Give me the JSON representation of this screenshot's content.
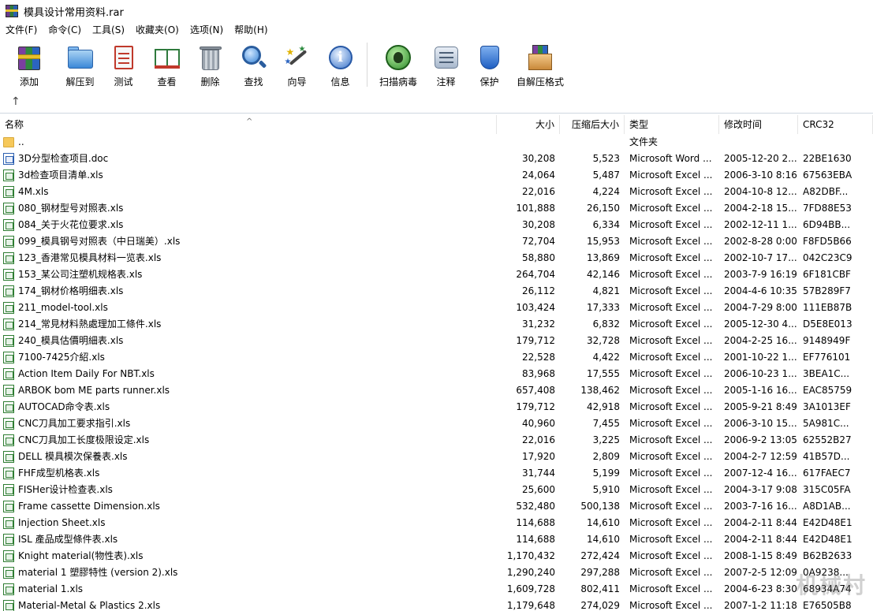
{
  "window": {
    "title": "模具设计常用资料.rar"
  },
  "menu": [
    "文件(F)",
    "命令(C)",
    "工具(S)",
    "收藏夹(O)",
    "选项(N)",
    "帮助(H)"
  ],
  "toolbar": {
    "add": "添加",
    "extract": "解压到",
    "test": "测试",
    "view": "查看",
    "delete": "删除",
    "find": "查找",
    "wizard": "向导",
    "info": "信息",
    "virus_scan": "扫描病毒",
    "comment": "注释",
    "protect": "保护",
    "sfx": "自解压格式"
  },
  "nav": {
    "up_icon": "up-arrow-icon"
  },
  "columns": {
    "name": "名称",
    "size": "大小",
    "packed": "压缩后大小",
    "type": "类型",
    "modified": "修改时间",
    "crc": "CRC32"
  },
  "files": [
    {
      "name": "..",
      "size": "",
      "packed": "",
      "type": "文件夹",
      "modified": "",
      "crc": "",
      "icon": "folder-icon"
    },
    {
      "name": "3D分型检查项目.doc",
      "size": "30,208",
      "packed": "5,523",
      "type": "Microsoft Word ...",
      "modified": "2005-12-20 2...",
      "crc": "22BE1630",
      "icon": "word-doc-icon"
    },
    {
      "name": "3d检查项目清单.xls",
      "size": "24,064",
      "packed": "5,487",
      "type": "Microsoft Excel ...",
      "modified": "2006-3-10 8:16",
      "crc": "67563EBA",
      "icon": "excel-xls-icon"
    },
    {
      "name": "4M.xls",
      "size": "22,016",
      "packed": "4,224",
      "type": "Microsoft Excel ...",
      "modified": "2004-10-8 12...",
      "crc": "A82DBF...",
      "icon": "excel-xls-icon"
    },
    {
      "name": "080_钢材型号对照表.xls",
      "size": "101,888",
      "packed": "26,150",
      "type": "Microsoft Excel ...",
      "modified": "2004-2-18 15...",
      "crc": "7FD88E53",
      "icon": "excel-xls-icon"
    },
    {
      "name": "084_关于火花位要求.xls",
      "size": "30,208",
      "packed": "6,334",
      "type": "Microsoft Excel ...",
      "modified": "2002-12-11 1...",
      "crc": "6D94BB...",
      "icon": "excel-xls-icon"
    },
    {
      "name": "099_模具钢号对照表（中日瑞美）.xls",
      "size": "72,704",
      "packed": "15,953",
      "type": "Microsoft Excel ...",
      "modified": "2002-8-28 0:00",
      "crc": "F8FD5B66",
      "icon": "excel-xls-icon"
    },
    {
      "name": "123_香港常见模具材料一览表.xls",
      "size": "58,880",
      "packed": "13,869",
      "type": "Microsoft Excel ...",
      "modified": "2002-10-7 17...",
      "crc": "042C23C9",
      "icon": "excel-xls-icon"
    },
    {
      "name": "153_某公司注塑机规格表.xls",
      "size": "264,704",
      "packed": "42,146",
      "type": "Microsoft Excel ...",
      "modified": "2003-7-9 16:19",
      "crc": "6F181CBF",
      "icon": "excel-xls-icon"
    },
    {
      "name": "174_钢材价格明细表.xls",
      "size": "26,112",
      "packed": "4,821",
      "type": "Microsoft Excel ...",
      "modified": "2004-4-6 10:35",
      "crc": "57B289F7",
      "icon": "excel-xls-icon"
    },
    {
      "name": "211_model-tool.xls",
      "size": "103,424",
      "packed": "17,333",
      "type": "Microsoft Excel ...",
      "modified": "2004-7-29 8:00",
      "crc": "111EB87B",
      "icon": "excel-xls-icon"
    },
    {
      "name": "214_常見材料熱處理加工條件.xls",
      "size": "31,232",
      "packed": "6,832",
      "type": "Microsoft Excel ...",
      "modified": "2005-12-30 4...",
      "crc": "D5E8E013",
      "icon": "excel-xls-icon"
    },
    {
      "name": "240_模具估價明細表.xls",
      "size": "179,712",
      "packed": "32,728",
      "type": "Microsoft Excel ...",
      "modified": "2004-2-25 16...",
      "crc": "9148949F",
      "icon": "excel-xls-icon"
    },
    {
      "name": "7100-7425介紹.xls",
      "size": "22,528",
      "packed": "4,422",
      "type": "Microsoft Excel ...",
      "modified": "2001-10-22 1...",
      "crc": "EF776101",
      "icon": "excel-xls-icon"
    },
    {
      "name": "Action Item Daily For NBT.xls",
      "size": "83,968",
      "packed": "17,555",
      "type": "Microsoft Excel ...",
      "modified": "2006-10-23 1...",
      "crc": "3BEA1C...",
      "icon": "excel-xls-icon"
    },
    {
      "name": "ARBOK bom ME parts runner.xls",
      "size": "657,408",
      "packed": "138,462",
      "type": "Microsoft Excel ...",
      "modified": "2005-1-16 16...",
      "crc": "EAC85759",
      "icon": "excel-xls-icon"
    },
    {
      "name": "AUTOCAD命令表.xls",
      "size": "179,712",
      "packed": "42,918",
      "type": "Microsoft Excel ...",
      "modified": "2005-9-21 8:49",
      "crc": "3A1013EF",
      "icon": "excel-xls-icon"
    },
    {
      "name": "CNC刀具加工要求指引.xls",
      "size": "40,960",
      "packed": "7,455",
      "type": "Microsoft Excel ...",
      "modified": "2006-3-10 15...",
      "crc": "5A981C...",
      "icon": "excel-xls-icon"
    },
    {
      "name": "CNC刀具加工长度极限设定.xls",
      "size": "22,016",
      "packed": "3,225",
      "type": "Microsoft Excel ...",
      "modified": "2006-9-2 13:05",
      "crc": "62552B27",
      "icon": "excel-xls-icon"
    },
    {
      "name": "DELL 模具模次保養表.xls",
      "size": "17,920",
      "packed": "2,809",
      "type": "Microsoft Excel ...",
      "modified": "2004-2-7 12:59",
      "crc": "41B57D...",
      "icon": "excel-xls-icon"
    },
    {
      "name": "FHF成型机格表.xls",
      "size": "31,744",
      "packed": "5,199",
      "type": "Microsoft Excel ...",
      "modified": "2007-12-4 16...",
      "crc": "617FAEC7",
      "icon": "excel-xls-icon"
    },
    {
      "name": "FISHer设计检查表.xls",
      "size": "25,600",
      "packed": "5,910",
      "type": "Microsoft Excel ...",
      "modified": "2004-3-17 9:08",
      "crc": "315C05FA",
      "icon": "excel-xls-icon"
    },
    {
      "name": "Frame cassette Dimension.xls",
      "size": "532,480",
      "packed": "500,138",
      "type": "Microsoft Excel ...",
      "modified": "2003-7-16 16...",
      "crc": "A8D1AB...",
      "icon": "excel-xls-icon"
    },
    {
      "name": "Injection Sheet.xls",
      "size": "114,688",
      "packed": "14,610",
      "type": "Microsoft Excel ...",
      "modified": "2004-2-11 8:44",
      "crc": "E42D48E1",
      "icon": "excel-xls-icon"
    },
    {
      "name": "ISL 產品成型條件表.xls",
      "size": "114,688",
      "packed": "14,610",
      "type": "Microsoft Excel ...",
      "modified": "2004-2-11 8:44",
      "crc": "E42D48E1",
      "icon": "excel-xls-icon"
    },
    {
      "name": "Knight material(物性表).xls",
      "size": "1,170,432",
      "packed": "272,424",
      "type": "Microsoft Excel ...",
      "modified": "2008-1-15 8:49",
      "crc": "B62B2633",
      "icon": "excel-xls-icon"
    },
    {
      "name": "material 1 塑膠特性 (version 2).xls",
      "size": "1,290,240",
      "packed": "297,288",
      "type": "Microsoft Excel ...",
      "modified": "2007-2-5 12:09",
      "crc": "0A9238...",
      "icon": "excel-xls-icon"
    },
    {
      "name": "material 1.xls",
      "size": "1,609,728",
      "packed": "802,411",
      "type": "Microsoft Excel ...",
      "modified": "2004-6-23 8:30",
      "crc": "68934A74",
      "icon": "excel-xls-icon"
    },
    {
      "name": "Material-Metal & Plastics 2.xls",
      "size": "1,179,648",
      "packed": "274,029",
      "type": "Microsoft Excel ...",
      "modified": "2007-1-2 11:18",
      "crc": "E76505B8",
      "icon": "excel-xls-icon"
    }
  ],
  "watermark": "机械村"
}
